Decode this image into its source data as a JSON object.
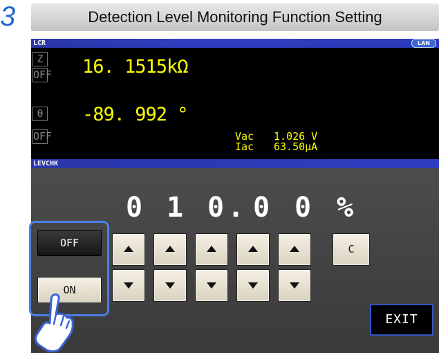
{
  "step": "3",
  "title": "Detection Level Monitoring Function Setting",
  "status_bar": {
    "mode": "LCR",
    "lan": "LAN"
  },
  "measurements": [
    {
      "param": "Z",
      "state": "OFF",
      "value": "16. 1515kΩ"
    },
    {
      "param": "θ",
      "state": "OFF",
      "value": "-89. 992 °"
    }
  ],
  "monitor": {
    "vac_label": "Vac",
    "vac_value": "1.026 V",
    "iac_label": "Iac",
    "iac_value": "63.50μA"
  },
  "levchk": {
    "header": "LEVCHK",
    "digits": [
      "0",
      "1",
      "0",
      ".",
      "0",
      "0",
      "%"
    ],
    "off_label": "OFF",
    "on_label": "ON",
    "clear_label": "C",
    "exit_label": "EXIT",
    "selected": "OFF"
  },
  "colors": {
    "accent": "#4d7fe8",
    "readout": "#ffff00",
    "step": "#2266cc"
  },
  "icons": [
    "caret-up-icon",
    "caret-down-icon",
    "pointing-hand-icon"
  ]
}
